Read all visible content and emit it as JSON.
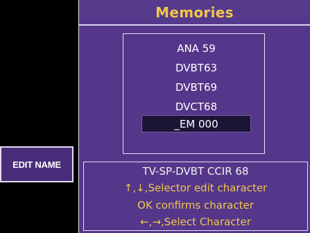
{
  "osd": {
    "title": "Memories",
    "memories": [
      "ANA 59",
      "DVBT63",
      "DVBT69",
      "DVCT68",
      "_EM 000"
    ],
    "selected_index": 4,
    "info": {
      "line1": "TV-SP-DVBT CCIR  68",
      "line2": "↑,↓,Selector edit character",
      "line3": "OK confirms character",
      "line4": "←,→,Select Character"
    },
    "colors": {
      "panel": "#54368a",
      "title_text": "#f2c64a",
      "hint_text": "#f2c64a",
      "selection": "#1c1436"
    }
  },
  "side_menu": {
    "edit_name_label": "EDIT NAME"
  }
}
